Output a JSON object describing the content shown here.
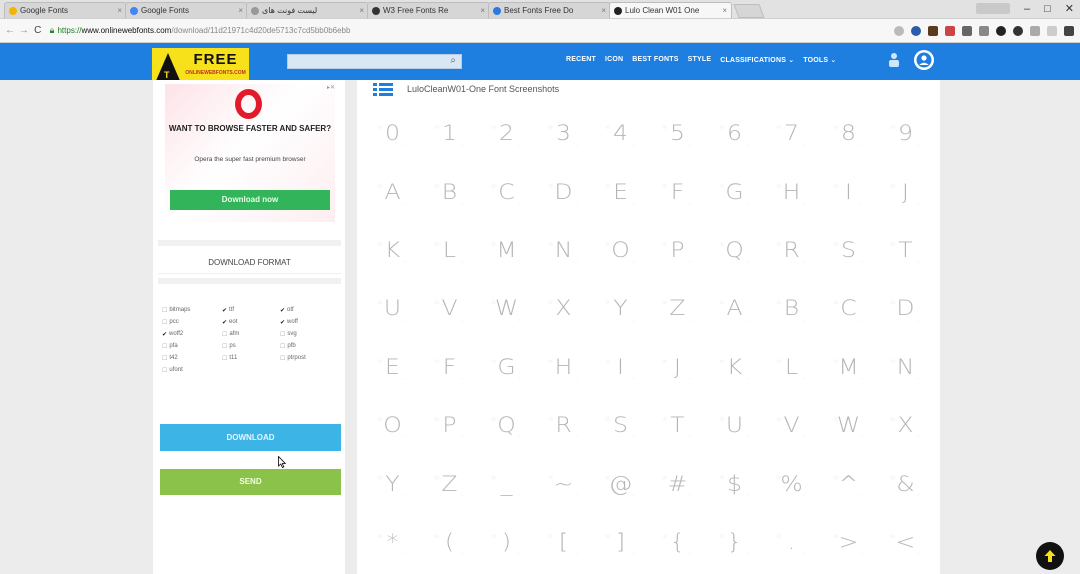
{
  "browser": {
    "tabs": [
      {
        "label": "Google Fonts",
        "color": "#f4b400"
      },
      {
        "label": "Google Fonts",
        "color": "#4285f4"
      },
      {
        "label": "لیست فونت های",
        "color": "#999999"
      },
      {
        "label": "W3 Free Fonts Re",
        "color": "#333333"
      },
      {
        "label": "Best Fonts Free Do",
        "color": "#2a7ae2"
      },
      {
        "label": "Lulo Clean W01 One",
        "color": "#222222",
        "active": true
      }
    ],
    "url": {
      "scheme": "https://",
      "domain": "www.onlinewebfonts.com",
      "path": "/download/11d21971c4d20de5713c7cd5bb0b6ebb"
    }
  },
  "header": {
    "logo_text": "FREE",
    "logo_subtext": "ONLINEWEBFONTS.COM",
    "search_placeholder": "",
    "nav": [
      "RECENT",
      "ICON",
      "BEST FONTS",
      "STYLE",
      "CLASSIFICATIONS ⌄",
      "TOOLS ⌄"
    ]
  },
  "sidebar": {
    "ad": {
      "headline": "WANT TO BROWSE FASTER AND SAFER?",
      "body": "Opera the super fast premium browser",
      "button": "Download now"
    },
    "download_format_title": "DOWNLOAD FORMAT",
    "formats": [
      {
        "label": "bitmaps",
        "checked": false
      },
      {
        "label": "ttf",
        "checked": true
      },
      {
        "label": "otf",
        "checked": true
      },
      {
        "label": "pcc",
        "checked": false
      },
      {
        "label": "eot",
        "checked": true
      },
      {
        "label": "woff",
        "checked": true
      },
      {
        "label": "woff2",
        "checked": true
      },
      {
        "label": "afm",
        "checked": false
      },
      {
        "label": "svg",
        "checked": false
      },
      {
        "label": "pfa",
        "checked": false
      },
      {
        "label": "ps",
        "checked": false
      },
      {
        "label": "pfb",
        "checked": false
      },
      {
        "label": "t42",
        "checked": false
      },
      {
        "label": "t11",
        "checked": false
      },
      {
        "label": "ptrpost",
        "checked": false
      },
      {
        "label": "ufont",
        "checked": false
      }
    ],
    "download_button": "DOWNLOAD",
    "send_button": "SEND"
  },
  "main": {
    "screenshot_title": "LuloCleanW01-One Font Screenshots",
    "glyphs": [
      "0",
      "1",
      "2",
      "3",
      "4",
      "5",
      "6",
      "7",
      "8",
      "9",
      "A",
      "B",
      "C",
      "D",
      "E",
      "F",
      "G",
      "H",
      "I",
      "J",
      "K",
      "L",
      "M",
      "N",
      "O",
      "P",
      "Q",
      "R",
      "S",
      "T",
      "U",
      "V",
      "W",
      "X",
      "Y",
      "Z",
      "A",
      "B",
      "C",
      "D",
      "E",
      "F",
      "G",
      "H",
      "I",
      "J",
      "K",
      "L",
      "M",
      "N",
      "O",
      "P",
      "Q",
      "R",
      "S",
      "T",
      "U",
      "V",
      "W",
      "X",
      "Y",
      "Z",
      "_",
      "~",
      "@",
      "#",
      "$",
      "%",
      "^",
      "&",
      "*",
      "(",
      ")",
      "[",
      "]",
      "{",
      "}",
      ".",
      ">",
      "<"
    ]
  },
  "colors": {
    "header_blue": "#1e7fe0",
    "logo_yellow": "#f6e11a",
    "download_blue": "#3db4e6",
    "send_green": "#8bc34a",
    "ad_green": "#32b55a",
    "opera_red": "#e21b2b"
  }
}
